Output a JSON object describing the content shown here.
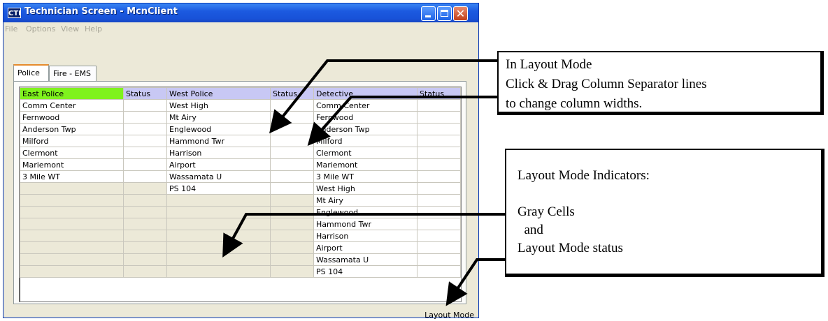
{
  "window": {
    "icon_text": "CTI",
    "title": "Technician Screen - McnClient"
  },
  "menu": [
    "File",
    "Options",
    "View",
    "Help"
  ],
  "tabs": [
    "Police",
    "Fire - EMS"
  ],
  "grid": {
    "headers": [
      "East Police",
      "Status",
      "West Police",
      "Status",
      "Detective",
      "Status"
    ],
    "header_colors": [
      "#7ff21d",
      "#c8c8f4",
      "#c8c8f4",
      "#c8c8f4",
      "#c8c8f4",
      "#c8c8f4"
    ],
    "columns": {
      "east_police": [
        "Comm Center",
        "Fernwood",
        "Anderson Twp",
        "Milford",
        "Clermont",
        "Mariemont",
        "3 Mile WT"
      ],
      "west_police": [
        "West High",
        "Mt Airy",
        "Englewood",
        "Hammond Twr",
        "Harrison",
        "Airport",
        "Wassamata U",
        "PS 104"
      ],
      "detective": [
        "Comm Center",
        "Fernwood",
        "Anderson Twp",
        "Milford",
        "Clermont",
        "Mariemont",
        "3 Mile WT",
        "West High",
        "Mt Airy",
        "Englewood",
        "Hammond Twr",
        "Harrison",
        "Airport",
        "Wassamata U",
        "PS 104"
      ]
    },
    "gray_cell_color": "#ece9d8"
  },
  "status_bar": {
    "text": "Layout Mode"
  },
  "callouts": {
    "top": [
      "In Layout Mode",
      "Click & Drag Column Separator lines",
      "to change column widths."
    ],
    "bottom": [
      "Layout Mode Indicators:",
      "",
      "Gray Cells",
      "  and",
      "Layout Mode status"
    ]
  }
}
